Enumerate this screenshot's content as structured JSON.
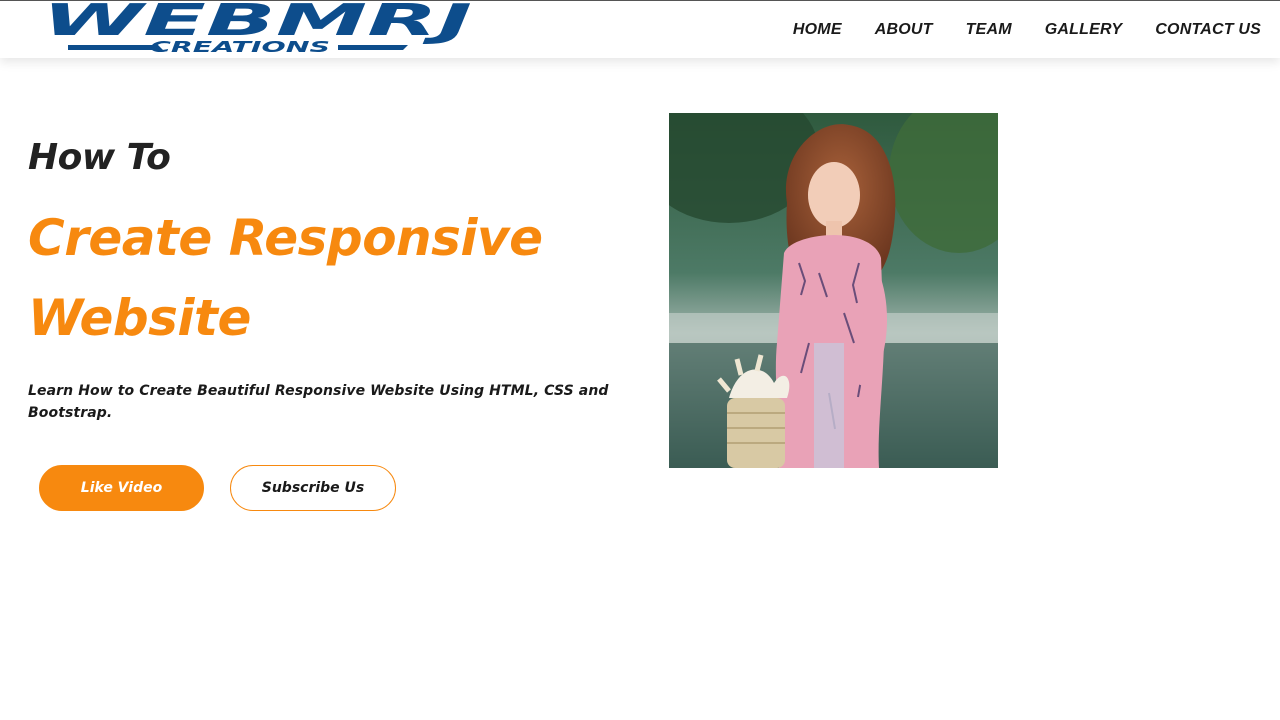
{
  "brand": {
    "logo_main": "WEBMRJ",
    "logo_sub": "CREATIONS",
    "logo_color": "#0d4d8c"
  },
  "nav": {
    "items": [
      {
        "label": "HOME"
      },
      {
        "label": "ABOUT"
      },
      {
        "label": "TEAM"
      },
      {
        "label": "GALLERY"
      },
      {
        "label": "CONTACT US"
      }
    ]
  },
  "hero": {
    "eyebrow": "How To",
    "title_line1": "Create Responsive",
    "title_line2": "Website",
    "subtitle": "Learn How to Create Beautiful Responsive Website Using HTML, CSS and Bootstrap.",
    "primary_button": "Like Video",
    "secondary_button": "Subscribe Us",
    "image_icon": "woman-photo"
  },
  "colors": {
    "accent": "#f7890f",
    "text_dark": "#222222",
    "brand_blue": "#0d4d8c"
  }
}
